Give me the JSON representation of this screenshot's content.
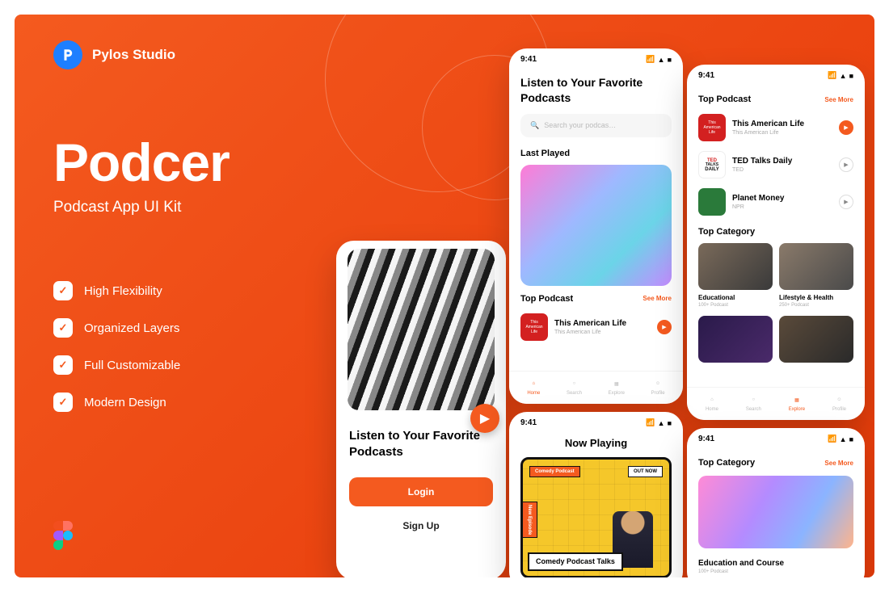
{
  "brand": {
    "name": "Pylos Studio"
  },
  "hero": {
    "title": "Podcer",
    "subtitle": "Podcast App UI Kit"
  },
  "features": [
    "High Flexibility",
    "Organized Layers",
    "Full Customizable",
    "Modern Design"
  ],
  "statusbar": {
    "time": "9:41"
  },
  "screen1": {
    "title": "Listen to Your Favorite Podcasts",
    "login": "Login",
    "signup": "Sign Up"
  },
  "screen2": {
    "title": "Listen to Your Favorite Podcasts",
    "search_placeholder": "Search your podcas…",
    "last_played": "Last Played",
    "top_podcast": "Top Podcast",
    "see_more": "See More",
    "podcast": {
      "name": "This American Life",
      "sub": "This American Life"
    },
    "nav": [
      "Home",
      "Search",
      "Explore",
      "Profile"
    ]
  },
  "screen3": {
    "top_podcast": "Top Podcast",
    "see_more": "See More",
    "podcasts": [
      {
        "name": "This American Life",
        "sub": "This American Life"
      },
      {
        "name": "TED Talks Daily",
        "sub": "TED"
      },
      {
        "name": "Planet Money",
        "sub": "NPR"
      }
    ],
    "top_category": "Top Category",
    "categories": [
      {
        "name": "Educational",
        "sub": "100+ Podcast"
      },
      {
        "name": "Lifestyle & Health",
        "sub": "250+ Podcast"
      }
    ],
    "nav": [
      "Home",
      "Search",
      "Explore",
      "Profile"
    ]
  },
  "screen4": {
    "title": "Now Playing",
    "badge1": "Comedy Podcast",
    "badge2": "OUT NOW",
    "badge3": "New Episode",
    "label": "Comedy Podcast Talks"
  },
  "screen5": {
    "top_category": "Top Category",
    "see_more": "See More",
    "category": {
      "name": "Education and Course",
      "sub": "100+ Podcast"
    }
  }
}
